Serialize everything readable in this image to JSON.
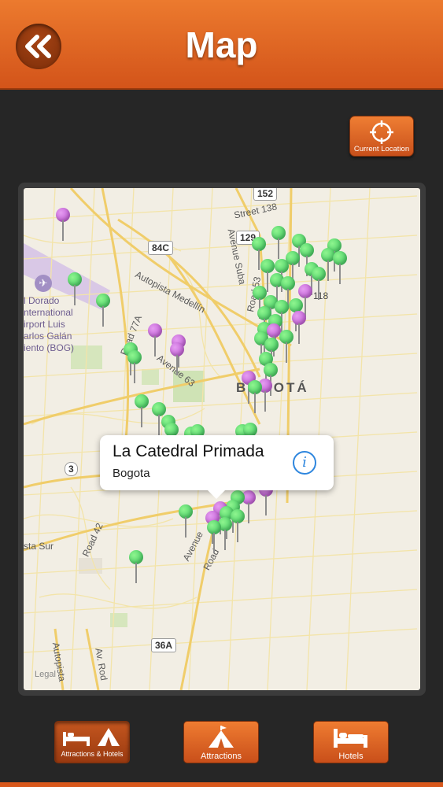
{
  "header": {
    "title": "Map",
    "back_icon": "double-chevron-left-icon"
  },
  "current_location": {
    "label": "Current Location",
    "icon": "crosshair-icon"
  },
  "map": {
    "road_labels": [
      "Street 138",
      "Avenue Suba",
      "Autopista Medellín",
      "Road 77A",
      "Avenue 63",
      "Road 53",
      "Avenue",
      "Road",
      "Road 42",
      "Autopista",
      "Av. Rod",
      "sta Sur"
    ],
    "airport_label": "l Dorado\nnternational\nirport Luis\narlos Galán\niento (BOG)",
    "shields": [
      "152",
      "129",
      "84C",
      "118",
      "3",
      "36A"
    ],
    "city_label": "BOGOTÁ",
    "legal": "Legal",
    "pin_colors": {
      "green": "#35c25a",
      "purple": "#b74dcc"
    }
  },
  "callout": {
    "title": "La Catedral Primada",
    "subtitle": "Bogota",
    "info_icon": "info-icon"
  },
  "tabs": [
    {
      "label": "Attractions & Hotels",
      "icon": "bed-tent-icon",
      "active": true
    },
    {
      "label": "Attractions",
      "icon": "tent-icon",
      "active": false
    },
    {
      "label": "Hotels",
      "icon": "bed-icon",
      "active": false
    }
  ],
  "colors": {
    "accent": "#e0682a",
    "background": "#262626"
  }
}
